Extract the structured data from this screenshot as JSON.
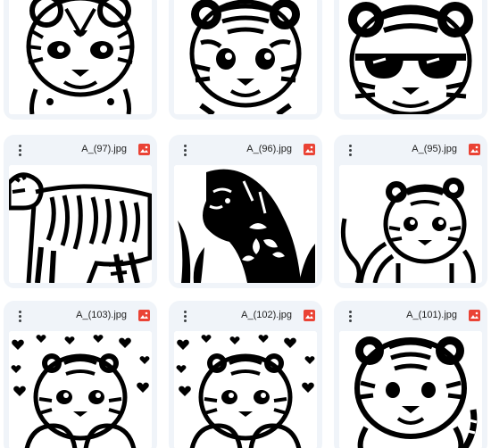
{
  "files": [
    {
      "name": ""
    },
    {
      "name": ""
    },
    {
      "name": ""
    },
    {
      "name": "A_(97).jpg"
    },
    {
      "name": "A_(96).jpg"
    },
    {
      "name": "A_(95).jpg"
    },
    {
      "name": "A_(103).jpg"
    },
    {
      "name": "A_(102).jpg"
    },
    {
      "name": "A_(101).jpg"
    }
  ],
  "colors": {
    "card_bg": "#f0f4f9",
    "image_icon": "#ea4335",
    "ink": "#000000"
  },
  "icons": [
    "more-vert-icon",
    "image-file-icon"
  ]
}
